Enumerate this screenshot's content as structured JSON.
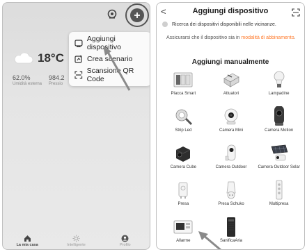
{
  "left_screen": {
    "weather": {
      "temperature": "18°C",
      "icon": "cloud-icon"
    },
    "stats": [
      {
        "value": "62.0%",
        "label": "Umidità esterna"
      },
      {
        "value": "984.2",
        "label": "Pressio"
      }
    ],
    "menu": [
      {
        "label": "Aggiungi dispositivo",
        "icon": "add-device-icon"
      },
      {
        "label": "Crea scenario",
        "icon": "create-scene-icon"
      },
      {
        "label": "Scansione QR Code",
        "icon": "scan-icon"
      }
    ],
    "bottom_nav": [
      {
        "label": "La mia casa",
        "icon": "home-icon",
        "active": true
      },
      {
        "label": "Intelligente",
        "icon": "sun-icon",
        "active": false
      },
      {
        "label": "Profilo",
        "icon": "profile-icon",
        "active": false
      }
    ]
  },
  "right_screen": {
    "back_glyph": "<",
    "title": "Aggiungi dispositivo",
    "searching": "Ricerca dei dispositivi disponibili nelle vicinanze.",
    "hint_pre": "Assicurarsi che il dispositivo sia in ",
    "hint_highlight": "modalità di abbinamento",
    "hint_post": ".",
    "section_title": "Aggiungi manualmente",
    "devices": [
      "Placca Smart",
      "Attuatori",
      "Lampadine",
      "Strip Led",
      "Camera Mini",
      "Camera Motion",
      "Camera Cube",
      "Camera Outdoor",
      "Camera Outdoor Solar",
      "Presa",
      "Presa Schuko",
      "Multipresa",
      "Allarme",
      "SanificaAria"
    ]
  },
  "colors": {
    "accent": "#ff7a2b",
    "dark_button": "#555555",
    "inactive_nav": "#9a9a9a"
  }
}
